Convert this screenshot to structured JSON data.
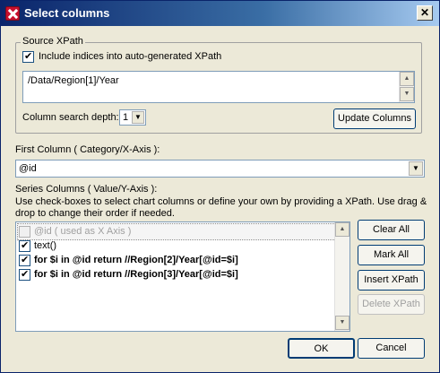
{
  "window": {
    "title": "Select columns",
    "close_label": "✕"
  },
  "source_xpath": {
    "group_label": "Source XPath",
    "include_indices_label": "Include indices into auto-generated XPath",
    "include_indices_checked": true,
    "xpath_value": "/Data/Region[1]/Year",
    "depth_label": "Column search depth:",
    "depth_value": "1",
    "update_button": "Update Columns"
  },
  "first_column": {
    "label": "First Column ( Category/X-Axis ):",
    "value": "@id"
  },
  "series": {
    "label": "Series Columns ( Value/Y-Axis ):",
    "help_line1": "Use check-boxes to select chart columns or define your own by providing a XPath. Use drag &",
    "help_line2": "drop to change their order if needed.",
    "items": [
      {
        "label": "@id ( used as X Axis )",
        "checked": false,
        "disabled": true
      },
      {
        "label": "text()",
        "checked": true,
        "disabled": false
      },
      {
        "label": "for $i in @id return //Region[2]/Year[@id=$i]",
        "checked": true,
        "disabled": false
      },
      {
        "label": "for $i in @id return //Region[3]/Year[@id=$i]",
        "checked": true,
        "disabled": false
      }
    ],
    "clear_all": "Clear All",
    "mark_all": "Mark All",
    "insert_xpath": "Insert XPath",
    "delete_xpath": "Delete XPath"
  },
  "footer": {
    "ok": "OK",
    "cancel": "Cancel"
  }
}
